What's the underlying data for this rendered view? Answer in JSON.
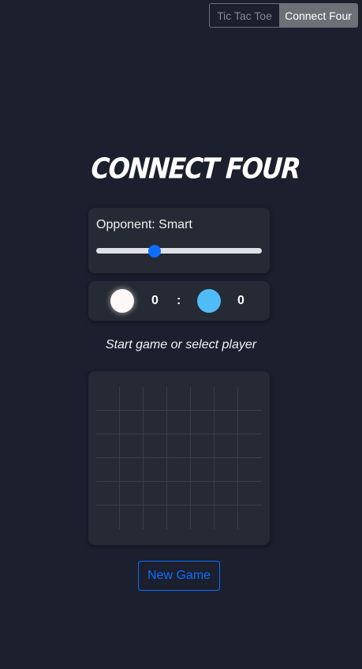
{
  "switcher": {
    "tabs": [
      {
        "label": "Tic Tac Toe",
        "active": false
      },
      {
        "label": "Connect Four",
        "active": true
      }
    ]
  },
  "title": "Connect Four",
  "opponent": {
    "label": "Opponent: Smart",
    "slider_fraction": 0.35,
    "thumb_color": "#0d6efd"
  },
  "score": {
    "player1": {
      "disc_color": "#fdf7f7",
      "score": "0"
    },
    "separator": ":",
    "player2": {
      "disc_color": "#4fbcf7",
      "score": "0"
    }
  },
  "status": "Start game or select player",
  "board": {
    "columns": 7,
    "rows": 6
  },
  "new_game_label": "New Game",
  "colors": {
    "background": "#1b1f2e",
    "card": "#262a34",
    "accent": "#0d6efd"
  }
}
